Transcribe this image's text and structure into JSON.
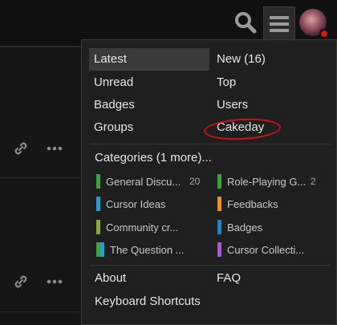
{
  "header": {
    "icons": {
      "search": "search-icon",
      "menu": "hamburger-icon"
    },
    "avatar_notification_color": "#d01818"
  },
  "background": {
    "row_actions": [
      {
        "link": "link-icon",
        "more": "more-icon"
      },
      {
        "link": "link-icon",
        "more": "more-icon"
      }
    ]
  },
  "menu": {
    "left": [
      "Latest",
      "Unread",
      "Badges",
      "Groups"
    ],
    "right": [
      "New (16)",
      "Top",
      "Users",
      "Cakeday"
    ],
    "active": "Latest",
    "categories_label": "Categories (1 more)...",
    "categories": [
      {
        "name": "General Discu...",
        "count": "20",
        "color": "#3aa63a"
      },
      {
        "name": "Role-Playing G...",
        "count": "2",
        "color": "#3aa63a"
      },
      {
        "name": "Cursor Ideas",
        "count": "",
        "color": "#1e9fd8"
      },
      {
        "name": "Feedbacks",
        "count": "",
        "color": "#f0901e"
      },
      {
        "name": "Community cr...",
        "count": "",
        "color": "#8fa83a"
      },
      {
        "name": "Badges",
        "count": "",
        "color": "#1a86c8"
      },
      {
        "name": "The Question ...",
        "count": "",
        "color": "#3aa63a",
        "color2": "#1e9fd8"
      },
      {
        "name": "Cursor Collecti...",
        "count": "",
        "color": "#a65ad8"
      }
    ],
    "footer": {
      "about": "About",
      "faq": "FAQ",
      "shortcuts": "Keyboard Shortcuts"
    },
    "highlight_color": "#d0101a"
  }
}
